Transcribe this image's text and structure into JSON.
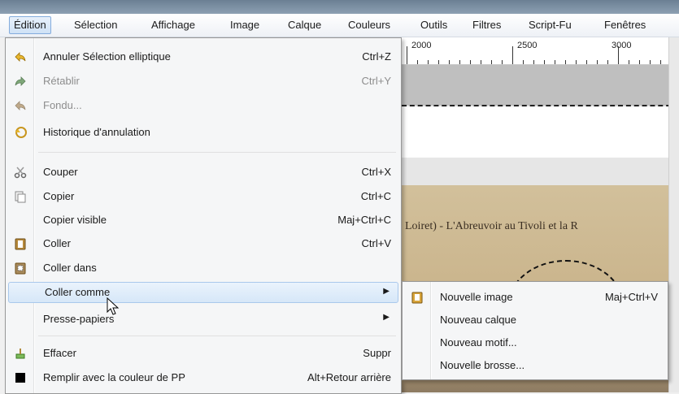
{
  "menubar": {
    "items": [
      {
        "label": "Édition",
        "active": true
      },
      {
        "label": "Sélection"
      },
      {
        "label": "Affichage"
      },
      {
        "label": "Image"
      },
      {
        "label": "Calque"
      },
      {
        "label": "Couleurs"
      },
      {
        "label": "Outils"
      },
      {
        "label": "Filtres"
      },
      {
        "label": "Script-Fu"
      },
      {
        "label": "Fenêtres"
      }
    ]
  },
  "ruler": {
    "labels": [
      "2000",
      "2500",
      "3000"
    ]
  },
  "canvas": {
    "photo_caption": "Loiret) - L'Abreuvoir au Tivoli et la R"
  },
  "menu": {
    "items": [
      {
        "label": "Annuler Sélection elliptique",
        "accel": "Ctrl+Z",
        "icon": "undo-icon"
      },
      {
        "label": "Rétablir",
        "accel": "Ctrl+Y",
        "icon": "redo-icon",
        "disabled": true
      },
      {
        "label": "Fondu...",
        "accel": "",
        "icon": "fade-icon",
        "disabled": true
      },
      {
        "label": "Historique d'annulation",
        "accel": "",
        "icon": "undo-history-icon"
      },
      {
        "label": "Couper",
        "accel": "Ctrl+X",
        "icon": "scissors-icon"
      },
      {
        "label": "Copier",
        "accel": "Ctrl+C",
        "icon": "copy-icon"
      },
      {
        "label": "Copier visible",
        "accel": "Maj+Ctrl+C",
        "icon": ""
      },
      {
        "label": "Coller",
        "accel": "Ctrl+V",
        "icon": "paste-icon"
      },
      {
        "label": "Coller dans",
        "accel": "",
        "icon": "paste-into-icon"
      },
      {
        "label": "Coller comme",
        "accel": "",
        "icon": "",
        "submenu": true,
        "highlighted": true
      },
      {
        "label": "Presse-papiers",
        "accel": "",
        "icon": "",
        "submenu": true
      },
      {
        "label": "Effacer",
        "accel": "Suppr",
        "icon": "clear-icon"
      },
      {
        "label": "Remplir avec la couleur de PP",
        "accel": "Alt+Retour arrière",
        "icon": "fill-fg-icon"
      }
    ]
  },
  "submenu": {
    "items": [
      {
        "label": "Nouvelle image",
        "accel": "Maj+Ctrl+V",
        "icon": "new-image-icon"
      },
      {
        "label": "Nouveau calque",
        "accel": ""
      },
      {
        "label": "Nouveau motif...",
        "accel": ""
      },
      {
        "label": "Nouvelle brosse...",
        "accel": ""
      }
    ]
  },
  "colors": {
    "highlight_border": "#a9c8ec",
    "disabled_text": "#8d8d8d"
  }
}
